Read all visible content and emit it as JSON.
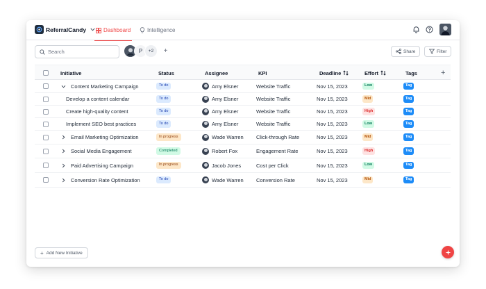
{
  "app": {
    "name": "ReferralCandy"
  },
  "nav": {
    "tabs": [
      {
        "label": "Dashboard",
        "active": true
      },
      {
        "label": "Intelligence",
        "active": false
      }
    ]
  },
  "toolbar": {
    "search_placeholder": "Search",
    "people": {
      "letter": "P",
      "more": "+2"
    },
    "share_label": "Share",
    "filter_label": "Filter"
  },
  "table": {
    "headers": {
      "initiative": "Initiative",
      "status": "Status",
      "assignee": "Assignee",
      "kpi": "KPI",
      "deadline": "Deadline",
      "effort": "Effort",
      "tags": "Tags"
    },
    "rows": [
      {
        "initiative": "Content Marketing Campaign",
        "expanded": true,
        "child": false,
        "status": "To do",
        "assignee": "Amy Elsner",
        "kpi": "Website Traffic",
        "deadline": "Nov 15, 2023",
        "effort": "Low",
        "tag": "Tag"
      },
      {
        "initiative": "Develop a content calendar",
        "child": true,
        "status": "To do",
        "assignee": "Amy Elsner",
        "kpi": "Website Traffic",
        "deadline": "Nov 15, 2023",
        "effort": "Mid",
        "tag": "Tag"
      },
      {
        "initiative": "Create high-quality content",
        "child": true,
        "status": "To do",
        "assignee": "Amy Elsner",
        "kpi": "Website Traffic",
        "deadline": "Nov 15, 2023",
        "effort": "High",
        "tag": "Tag"
      },
      {
        "initiative": "Implement SEO best practices",
        "child": true,
        "status": "To do",
        "assignee": "Amy Elsner",
        "kpi": "Website Traffic",
        "deadline": "Nov 15, 2023",
        "effort": "Low",
        "tag": "Tag"
      },
      {
        "initiative": "Email Marketing Optimization",
        "expanded": false,
        "child": false,
        "status": "In progress",
        "assignee": "Wade Warren",
        "kpi": "Click-through Rate",
        "deadline": "Nov 15, 2023",
        "effort": "Mid",
        "tag": "Tag"
      },
      {
        "initiative": "Social Media Engagement",
        "expanded": false,
        "child": false,
        "status": "Completed",
        "assignee": "Robert Fox",
        "kpi": "Engagement Rate",
        "deadline": "Nov 15, 2023",
        "effort": "High",
        "tag": "Tag"
      },
      {
        "initiative": "Paid Advertising Campaign",
        "expanded": false,
        "child": false,
        "status": "In progress",
        "assignee": "Jacob Jones",
        "kpi": "Cost per Click",
        "deadline": "Nov 15, 2023",
        "effort": "Low",
        "tag": "Tag"
      },
      {
        "initiative": "Conversion Rate Optimization",
        "expanded": false,
        "child": false,
        "status": "To do",
        "assignee": "Wade Warren",
        "kpi": "Conversion Rate",
        "deadline": "Nov 15, 2023",
        "effort": "Mid",
        "tag": "Tag"
      }
    ]
  },
  "footer": {
    "add_initiative_label": "Add New Initiative"
  },
  "colors": {
    "accent": "#ef4444",
    "tag": "#1d8cf8"
  },
  "icons": [
    "brand-logo-icon",
    "chevron-down-icon",
    "dashboard-grid-icon",
    "lightbulb-icon",
    "bell-icon",
    "help-icon",
    "search-icon",
    "share-icon",
    "filter-icon",
    "sort-icon",
    "chevron-right-icon",
    "plus-icon",
    "sparkle-icon"
  ]
}
